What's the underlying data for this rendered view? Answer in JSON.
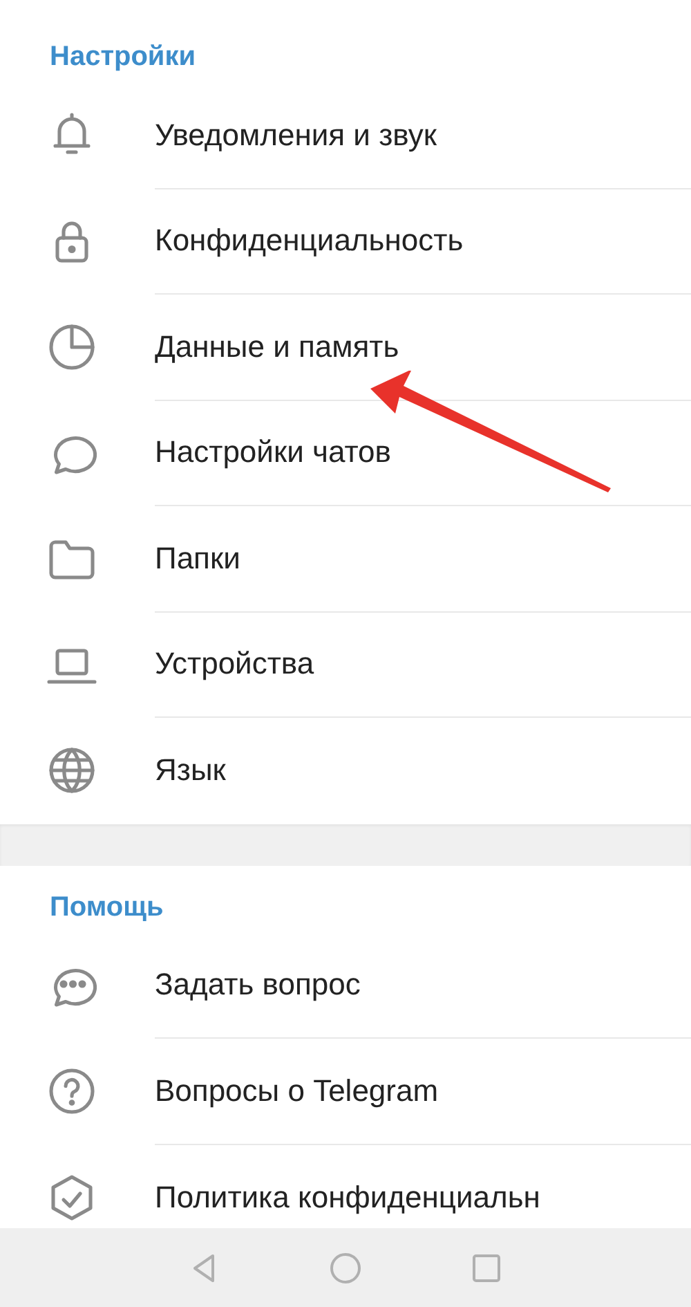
{
  "sections": [
    {
      "title": "Настройки",
      "items": [
        {
          "label": "Уведомления и звук"
        },
        {
          "label": "Конфиденциальность"
        },
        {
          "label": "Данные и память"
        },
        {
          "label": "Настройки чатов"
        },
        {
          "label": "Папки"
        },
        {
          "label": "Устройства"
        },
        {
          "label": "Язык"
        }
      ]
    },
    {
      "title": "Помощь",
      "items": [
        {
          "label": "Задать вопрос"
        },
        {
          "label": "Вопросы о Telegram"
        },
        {
          "label": "Политика конфиденциальн"
        }
      ]
    }
  ]
}
